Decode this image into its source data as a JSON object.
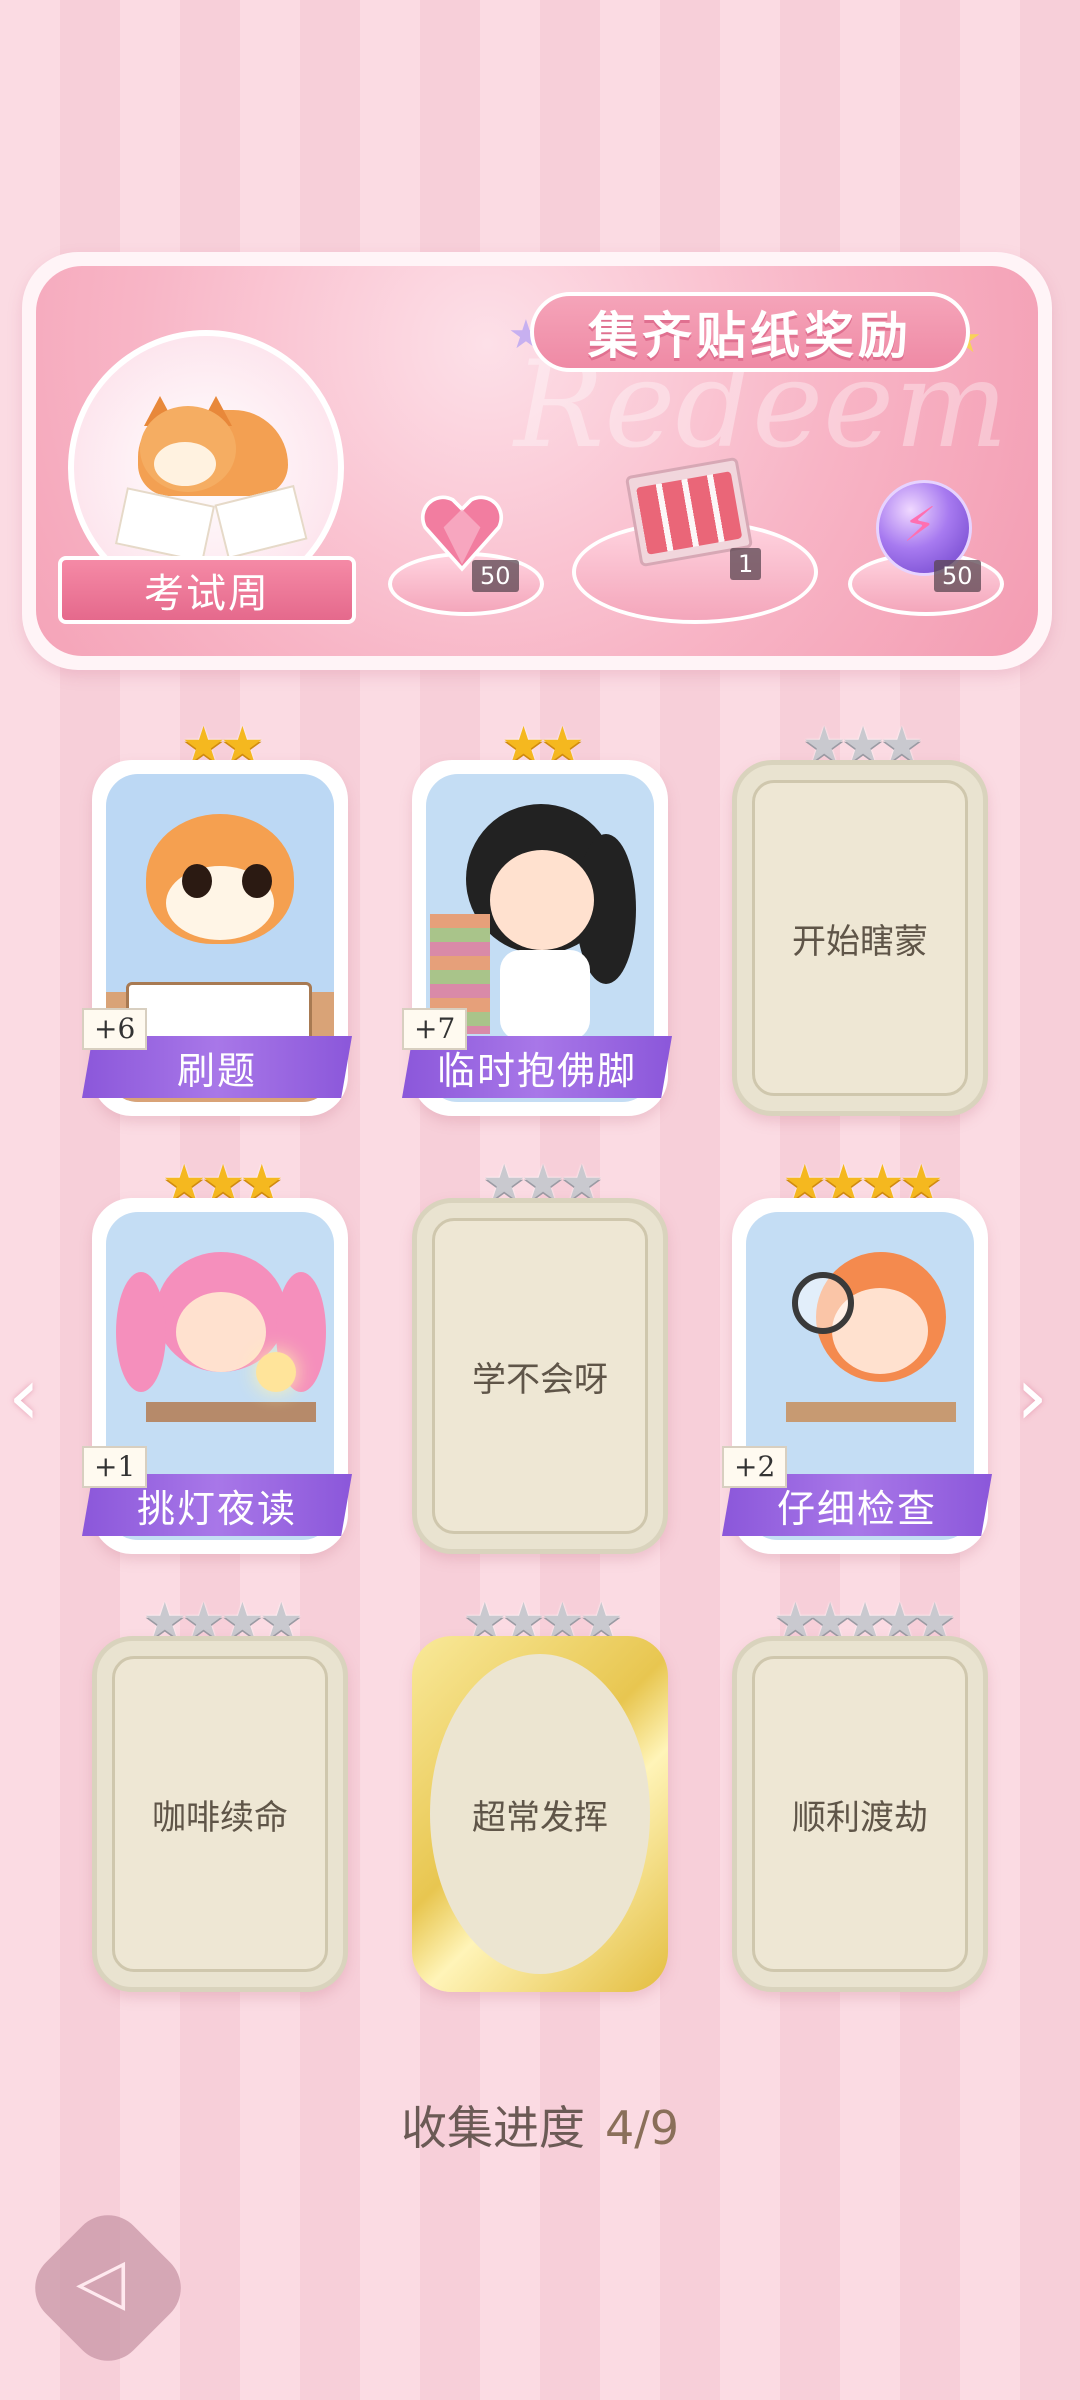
{
  "banner": {
    "title": "集齐贴纸奖励",
    "watermark": "Redeem",
    "theme_label": "考试周",
    "rewards": [
      {
        "icon": "heart-gem-icon",
        "count": "50"
      },
      {
        "icon": "gift-box-icon",
        "count": "1"
      },
      {
        "icon": "energy-orb-icon",
        "count": "50"
      }
    ]
  },
  "cards": [
    {
      "name": "刷题",
      "stars_earned": 2,
      "stars_total": 2,
      "bonus": "+6",
      "unlocked": true
    },
    {
      "name": "临时抱佛脚",
      "stars_earned": 2,
      "stars_total": 2,
      "bonus": "+7",
      "unlocked": true
    },
    {
      "name": "开始瞎蒙",
      "stars_earned": 0,
      "stars_total": 3,
      "unlocked": false
    },
    {
      "name": "挑灯夜读",
      "stars_earned": 3,
      "stars_total": 3,
      "bonus": "+1",
      "unlocked": true
    },
    {
      "name": "学不会呀",
      "stars_earned": 0,
      "stars_total": 3,
      "unlocked": false
    },
    {
      "name": "仔细检查",
      "stars_earned": 4,
      "stars_total": 4,
      "bonus": "+2",
      "unlocked": true
    },
    {
      "name": "咖啡续命",
      "stars_earned": 0,
      "stars_total": 4,
      "unlocked": false
    },
    {
      "name": "超常发挥",
      "stars_earned": 0,
      "stars_total": 4,
      "unlocked": false,
      "gold": true
    },
    {
      "name": "顺利渡劫",
      "stars_earned": 0,
      "stars_total": 5,
      "unlocked": false
    }
  ],
  "progress": {
    "label": "收集进度",
    "value": "4/9"
  },
  "nav": {
    "prev": "‹",
    "next": "›",
    "back_icon": "back-arrow-icon"
  },
  "colors": {
    "accent_pink": "#ef8aa5",
    "name_purple": "#8b57da",
    "star_gold": "#f5b81f",
    "star_silver": "#c9c9cf"
  }
}
